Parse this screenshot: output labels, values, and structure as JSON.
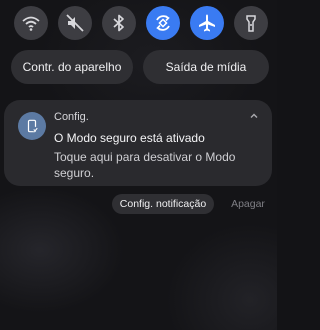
{
  "quick_settings": [
    {
      "name": "wifi",
      "icon": "wifi-icon",
      "state": "off"
    },
    {
      "name": "sound",
      "icon": "mute-icon",
      "state": "off"
    },
    {
      "name": "bluetooth",
      "icon": "bluetooth-icon",
      "state": "off"
    },
    {
      "name": "auto-rotate",
      "icon": "rotate-icon",
      "state": "on"
    },
    {
      "name": "airplane",
      "icon": "airplane-icon",
      "state": "on"
    },
    {
      "name": "flashlight",
      "icon": "flashlight-icon",
      "state": "off"
    }
  ],
  "controls": {
    "device_control": "Contr. do aparelho",
    "media_output": "Saída de mídia"
  },
  "notification": {
    "app": "Config.",
    "title": "O Modo seguro está ativado",
    "body": "Toque aqui para desativar o Modo seguro.",
    "actions": {
      "settings": "Config. notificação",
      "clear": "Apagar"
    }
  },
  "colors": {
    "accent_on": "#3a7bf2",
    "tile_off": "#3d3d42",
    "card_bg": "#2a2a2e"
  }
}
